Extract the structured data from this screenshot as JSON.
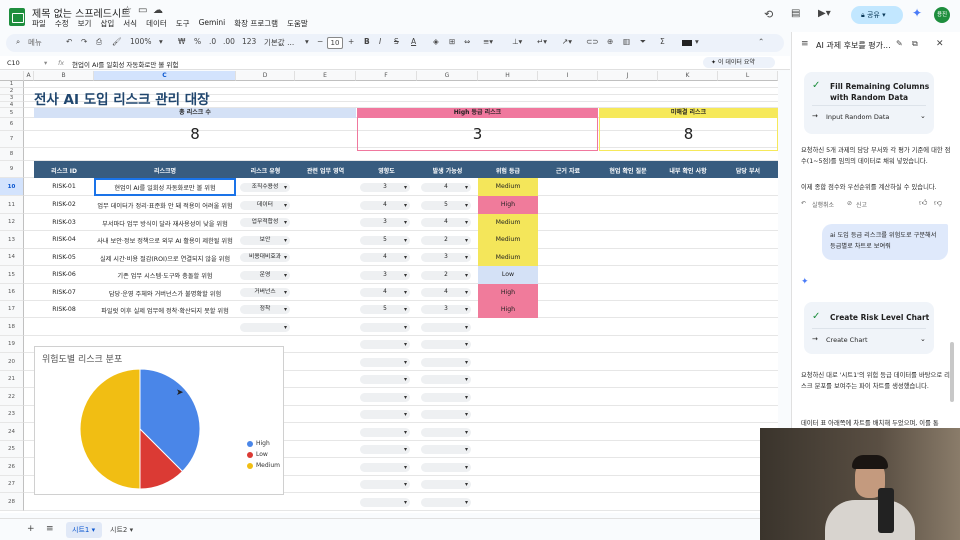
{
  "app": {
    "doc_title": "제목 없는 스프레드시트",
    "menus": [
      "파일",
      "수정",
      "보기",
      "삽입",
      "서식",
      "데이터",
      "도구",
      "Gemini",
      "확장 프로그램",
      "도움말"
    ],
    "share_label": "공유",
    "avatar_initials": "용진"
  },
  "toolbar": {
    "search": "메뉴",
    "zoom": "100%",
    "currency": "₩",
    "percent": "%",
    "dec_less": ".0",
    "dec_more": ".00",
    "num_fmt": "123",
    "font": "기본값 ...",
    "font_size": "10"
  },
  "formula": {
    "cell_ref": "C10",
    "content": "현업이 AI를 일회성 자동화로만 볼 위험",
    "summary_label": "이 데이터 요약"
  },
  "columns": [
    "A",
    "B",
    "C",
    "D",
    "E",
    "F",
    "G",
    "H",
    "I",
    "J",
    "K",
    "L"
  ],
  "sheet": {
    "title": "전사 AI 도입 리스크 관리 대장",
    "summary": [
      {
        "label": "총 리스크 수",
        "value": "8"
      },
      {
        "label": "High 등급 리스크",
        "value": "3"
      },
      {
        "label": "미해결 리스크",
        "value": "8"
      }
    ],
    "headers": [
      "리스크 ID",
      "리스크명",
      "리스크 유형",
      "관련 업무 영역",
      "영향도",
      "발생 가능성",
      "위험 등급",
      "근거 자료",
      "현업 확인 질문",
      "내부 확인 사항",
      "담당 부서"
    ],
    "rows": [
      {
        "id": "RISK-01",
        "name": "현업이 AI를 일회성 자동화로만 볼 위험",
        "type": "조직수용성",
        "impact": "3",
        "likelihood": "4",
        "level": "Medium"
      },
      {
        "id": "RISK-02",
        "name": "업무 데이터가 정리·표준화 안 돼 적용이 어려울 위험",
        "type": "데이터",
        "impact": "4",
        "likelihood": "5",
        "level": "High"
      },
      {
        "id": "RISK-03",
        "name": "부서마다 업무 방식이 달라 재사용성이 낮을 위험",
        "type": "업무적합성",
        "impact": "3",
        "likelihood": "4",
        "level": "Medium"
      },
      {
        "id": "RISK-04",
        "name": "사내 보안·정보 정책으로 외부 AI 활용이 제한될 위험",
        "type": "보안",
        "impact": "5",
        "likelihood": "2",
        "level": "Medium"
      },
      {
        "id": "RISK-05",
        "name": "실제 시간·비용 절감(ROI)으로 연결되지 않을 위험",
        "type": "비용대비효과",
        "impact": "4",
        "likelihood": "3",
        "level": "Medium"
      },
      {
        "id": "RISK-06",
        "name": "기존 업무 시스템·도구와 충돌할 위험",
        "type": "운영",
        "impact": "3",
        "likelihood": "2",
        "level": "Low"
      },
      {
        "id": "RISK-07",
        "name": "담당·운영 주체와 거버넌스가 불명확할 위험",
        "type": "거버넌스",
        "impact": "4",
        "likelihood": "4",
        "level": "High"
      },
      {
        "id": "RISK-08",
        "name": "파일럿 이후 실제 업무에 정착·확산되지 못할 위험",
        "type": "정착",
        "impact": "5",
        "likelihood": "3",
        "level": "High"
      }
    ],
    "row_numbers": [
      "1",
      "2",
      "3",
      "4",
      "5",
      "6",
      "7",
      "8",
      "9",
      "10",
      "11",
      "12",
      "13",
      "14",
      "15",
      "16",
      "17",
      "18",
      "19",
      "20",
      "21",
      "22",
      "23",
      "24",
      "25",
      "26",
      "27",
      "28"
    ]
  },
  "chart_data": {
    "type": "pie",
    "title": "위험도별 리스크 분포",
    "categories": [
      "High",
      "Low",
      "Medium"
    ],
    "values": [
      3,
      1,
      4
    ],
    "colors": [
      "#4a86e8",
      "#db3a34",
      "#f1be13"
    ],
    "legend": "right"
  },
  "side_panel": {
    "title": "AI 과제 후보를 평가...",
    "card1": {
      "title": "Fill Remaining Columns with Random Data",
      "step": "Input Random Data"
    },
    "msg1a": "요청하신 5개 과제의 담당 부서와 각 평가 기준에 대한 점수(1~5점)를 임의의 데이터로 채워 넣었습니다.",
    "msg1b": "이제 종합 점수와 우선순위를 계산하실 수 있습니다.",
    "undo": "실행취소",
    "report": "신고",
    "user_msg": "ai 도입 등급 리스크를 위험도로 구분해서 등급별로 차트로 보여줘",
    "card2": {
      "title": "Create Risk Level Chart",
      "step": "Create Chart"
    },
    "msg2a": "요청하신 대로 '시트1'의 위험 등급 데이터를 바탕으로 리스크 분포를 보여주는 파이 차트를 생성했습니다.",
    "msg2b": "데이터 표 아래쪽에 차트를 배치해 두었으며, 이를 통"
  },
  "tabs": {
    "sheet1": "시트1",
    "sheet2": "시트2"
  }
}
